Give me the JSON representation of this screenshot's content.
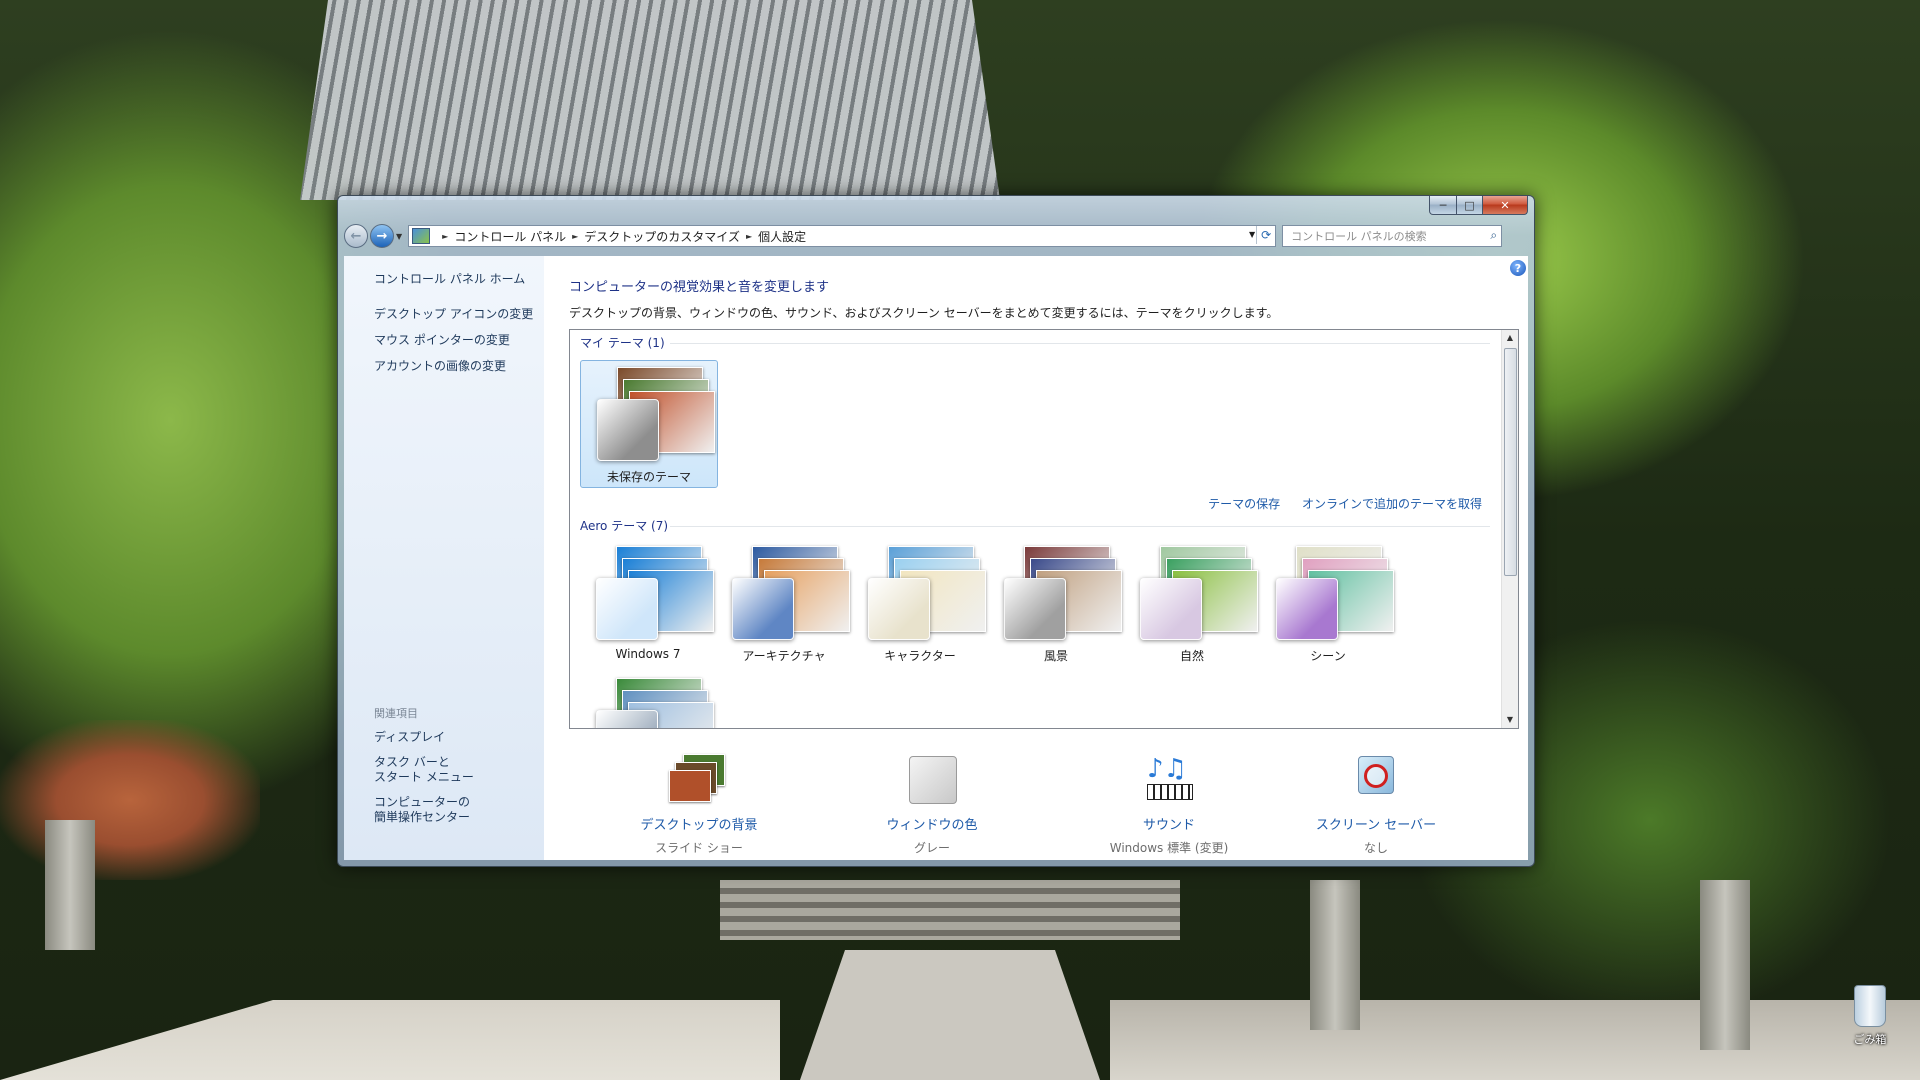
{
  "window": {
    "minimize_glyph": "─",
    "maximize_glyph": "□",
    "close_glyph": "✕"
  },
  "address_bar": {
    "breadcrumbs": [
      "コントロール パネル",
      "デスクトップのカスタマイズ",
      "個人設定"
    ],
    "search_placeholder": "コントロール パネルの検索"
  },
  "sidebar": {
    "home": "コントロール パネル ホーム",
    "links": [
      "デスクトップ アイコンの変更",
      "マウス ポインターの変更",
      "アカウントの画像の変更"
    ],
    "related_header": "関連項目",
    "related": [
      "ディスプレイ",
      "タスク バーと\nスタート メニュー",
      "コンピューターの\n簡単操作センター"
    ]
  },
  "main": {
    "title": "コンピューターの視覚効果と音を変更します",
    "description": "デスクトップの背景、ウィンドウの色、サウンド、およびスクリーン セーバーをまとめて変更するには、テーマをクリックします。",
    "my_themes_header": "マイ テーマ (1)",
    "my_themes": [
      {
        "label": "未保存のテーマ",
        "selected": true,
        "swatch": "#8e8e8e",
        "cards": [
          "#7b4a2a",
          "#4a7a30",
          "#c0502a"
        ]
      }
    ],
    "save_theme_link": "テーマの保存",
    "get_more_link": "オンラインで追加のテーマを取得",
    "aero_header": "Aero テーマ (7)",
    "aero_themes": [
      {
        "label": "Windows 7",
        "swatch": "#cfe6fa",
        "cards": [
          "#1a7fd6",
          "#1a7fd6",
          "#1a7fd6"
        ]
      },
      {
        "label": "アーキテクチャ",
        "swatch": "#5f86c4",
        "cards": [
          "#2d5aa0",
          "#c67a3a",
          "#e6a060"
        ]
      },
      {
        "label": "キャラクター",
        "swatch": "#e8e2cc",
        "cards": [
          "#5aa0d8",
          "#9ad0f0",
          "#f2e6c0"
        ]
      },
      {
        "label": "風景",
        "swatch": "#a0a0a0",
        "cards": [
          "#7a3a3a",
          "#3a4a8a",
          "#c0a080"
        ]
      },
      {
        "label": "自然",
        "swatch": "#d8c8e2",
        "cards": [
          "#a0c8a0",
          "#3aa060",
          "#8ac040"
        ]
      },
      {
        "label": "シーン",
        "swatch": "#a878d0",
        "cards": [
          "#e0e0c8",
          "#e0a0c0",
          "#60c0a0"
        ]
      },
      {
        "label": "",
        "swatch": "#9aaabb",
        "cards": [
          "#3a8a3a",
          "#6090c0",
          "#a0c0e0"
        ]
      }
    ]
  },
  "bottom_bar": [
    {
      "label": "デスクトップの背景",
      "value": "スライド ショー",
      "icon": "desktop-background-icon"
    },
    {
      "label": "ウィンドウの色",
      "value": "グレー",
      "icon": "window-color-icon"
    },
    {
      "label": "サウンド",
      "value": "Windows 標準 (変更)",
      "icon": "sound-icon"
    },
    {
      "label": "スクリーン セーバー",
      "value": "なし",
      "icon": "screen-saver-icon"
    }
  ],
  "desktop": {
    "recycle_bin_label": "ごみ箱"
  }
}
